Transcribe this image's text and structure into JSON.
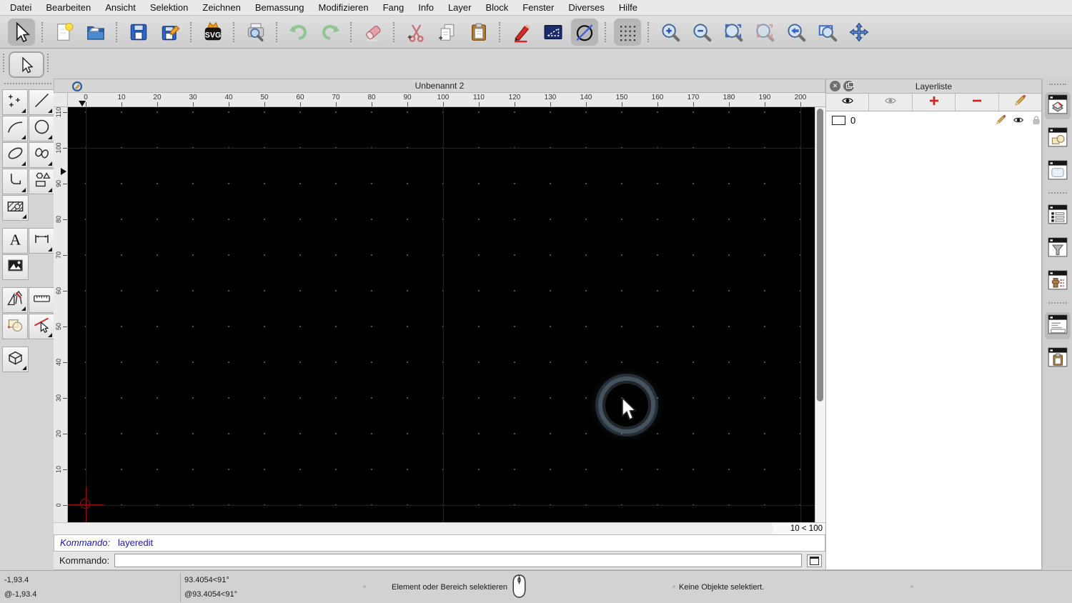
{
  "menubar": {
    "items": [
      "Datei",
      "Bearbeiten",
      "Ansicht",
      "Selektion",
      "Zeichnen",
      "Bemassung",
      "Modifizieren",
      "Fang",
      "Info",
      "Layer",
      "Block",
      "Fenster",
      "Diverses",
      "Hilfe"
    ]
  },
  "toolbar": {
    "svg_logo_text": "SVG",
    "buttons": [
      {
        "icon": "cursor",
        "name": "select-tool",
        "active": true
      },
      "|",
      {
        "icon": "newfile",
        "name": "new-file"
      },
      {
        "icon": "openfile",
        "name": "open-file"
      },
      "|",
      {
        "icon": "save",
        "name": "save-file"
      },
      {
        "icon": "saveas",
        "name": "save-file-as"
      },
      "|",
      {
        "icon": "svgexport",
        "name": "svg-export"
      },
      "|",
      {
        "icon": "preview",
        "name": "print-preview"
      },
      "|",
      {
        "icon": "undo",
        "name": "undo"
      },
      {
        "icon": "redo",
        "name": "redo"
      },
      "|",
      {
        "icon": "eraser",
        "name": "delete"
      },
      "|",
      {
        "icon": "cut",
        "name": "cut"
      },
      {
        "icon": "copy",
        "name": "copy"
      },
      {
        "icon": "paste",
        "name": "paste"
      },
      "|",
      {
        "icon": "redpencil",
        "name": "edit-drawing"
      },
      {
        "icon": "navyangle",
        "name": "measure-angle"
      },
      {
        "icon": "circleslash",
        "name": "restrict-nothing",
        "active": true
      },
      "|",
      {
        "icon": "griddots",
        "name": "grid-toggle",
        "active": true
      },
      "|",
      {
        "icon": "zoomin",
        "name": "zoom-in"
      },
      {
        "icon": "zoomout",
        "name": "zoom-out"
      },
      {
        "icon": "zoomauto",
        "name": "zoom-auto"
      },
      {
        "icon": "zoomsel",
        "name": "zoom-selection",
        "disabled": true
      },
      {
        "icon": "zoomprev",
        "name": "zoom-previous"
      },
      {
        "icon": "zoomwin",
        "name": "zoom-window"
      },
      {
        "icon": "pan",
        "name": "pan"
      }
    ]
  },
  "left_palette": {
    "text_glyph": "A",
    "rows": [
      {
        "cells": [
          {
            "icon": "points",
            "name": "points-tool",
            "sub": true
          },
          {
            "icon": "line",
            "name": "line-tool",
            "sub": true
          }
        ]
      },
      {
        "cells": [
          {
            "icon": "arc",
            "name": "arc-tool",
            "sub": true
          },
          {
            "icon": "circle",
            "name": "circle-tool",
            "sub": true
          }
        ]
      },
      {
        "cells": [
          {
            "icon": "ellipse",
            "name": "ellipse-tool",
            "sub": true
          },
          {
            "icon": "spline",
            "name": "spline-tool",
            "sub": true
          }
        ]
      },
      {
        "cells": [
          {
            "icon": "polyline",
            "name": "polyline-tool",
            "sub": true
          },
          {
            "icon": "shapes",
            "name": "shape-tools",
            "sub": true
          }
        ]
      },
      {
        "cells": [
          {
            "icon": "hatch",
            "name": "hatch-tool",
            "sub": true
          },
          null
        ]
      },
      {
        "gap": true,
        "cells": [
          {
            "icon": "texttool",
            "name": "text-tool"
          },
          {
            "icon": "dimension",
            "name": "dimension-tool",
            "sub": true
          }
        ]
      },
      {
        "cells": [
          {
            "icon": "image",
            "name": "image-tool"
          },
          null
        ]
      },
      {
        "gap": true,
        "cells": [
          {
            "icon": "miscdraw",
            "name": "misc-draw-tools",
            "sub": true
          },
          {
            "icon": "rulertool",
            "name": "measure-tool"
          }
        ]
      },
      {
        "cells": [
          {
            "icon": "modshapes",
            "name": "modify-tools"
          },
          {
            "icon": "modsel",
            "name": "modify-selection-tool",
            "sub": true
          }
        ]
      },
      {
        "gap": true,
        "cells": [
          {
            "icon": "box3d",
            "name": "viewport-tool",
            "sub": true
          },
          null
        ]
      }
    ]
  },
  "window": {
    "title": "Unbenannt 2"
  },
  "rulers": {
    "h_ticks": [
      "0",
      "10",
      "20",
      "30",
      "40",
      "50",
      "60",
      "70",
      "80",
      "90",
      "100",
      "110",
      "120",
      "130",
      "140",
      "150",
      "160",
      "170",
      "180",
      "190",
      "200"
    ],
    "v_ticks": [
      "0",
      "10",
      "20",
      "30",
      "40",
      "50",
      "60",
      "70",
      "80",
      "90",
      "100",
      "110"
    ]
  },
  "canvas": {
    "grid_info": "10 < 100"
  },
  "command": {
    "history_label": "Kommando:",
    "history_value": "layeredit",
    "input_label": "Kommando:",
    "input_value": ""
  },
  "layer_panel": {
    "title": "Layerliste",
    "toolbar": [
      {
        "icon": "eye",
        "name": "show-all-layers"
      },
      {
        "icon": "eyegray",
        "name": "hide-all-layers"
      },
      {
        "icon": "plusred",
        "name": "add-layer"
      },
      {
        "icon": "minusred",
        "name": "remove-layer"
      },
      {
        "icon": "pencil",
        "name": "edit-layer"
      }
    ],
    "layers": [
      {
        "name": "0"
      }
    ]
  },
  "right_dock": {
    "items": [
      {
        "icon": "d_layers",
        "name": "dock-layer-list",
        "active": true
      },
      {
        "icon": "d_blocks",
        "name": "dock-block-list"
      },
      {
        "icon": "d_view",
        "name": "dock-views"
      },
      "sep",
      {
        "icon": "d_props",
        "name": "dock-property-editor"
      },
      {
        "icon": "d_filter",
        "name": "dock-selection-filter"
      },
      {
        "icon": "d_lamp",
        "name": "dock-lighting"
      },
      "sep",
      {
        "icon": "d_cmd",
        "name": "dock-command-line",
        "active": true
      },
      {
        "icon": "d_clip",
        "name": "dock-clipboard"
      }
    ]
  },
  "statusbar": {
    "abs_coord": "-1,93.4",
    "rel_coord": "@-1,93.4",
    "abs_polar": "93.4054<91°",
    "rel_polar": "@93.4054<91°",
    "left_button_hint": "Element oder Bereich selektieren",
    "selection_status": "Keine Objekte selektiert."
  }
}
